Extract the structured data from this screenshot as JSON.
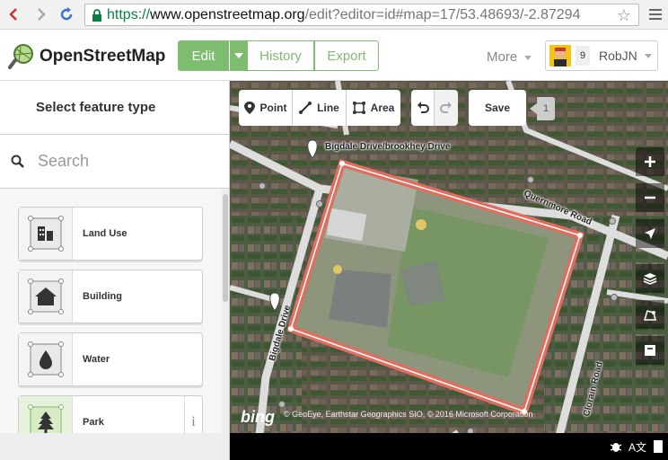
{
  "browser": {
    "url_scheme": "https://",
    "url_host": "www.openstreetmap.org",
    "url_path": "/edit?editor=id#map=17/53.48693/-2.87294"
  },
  "header": {
    "site_name": "OpenStreetMap",
    "tabs": {
      "edit": "Edit",
      "history": "History",
      "export": "Export"
    },
    "more_label": "More",
    "user": {
      "count": "9",
      "name": "RobJN"
    }
  },
  "sidebar": {
    "title": "Select feature type",
    "search_placeholder": "Search",
    "presets": [
      {
        "label": "Land Use",
        "icon": "land-use-icon"
      },
      {
        "label": "Building",
        "icon": "building-icon"
      },
      {
        "label": "Water",
        "icon": "water-icon"
      },
      {
        "label": "Park",
        "icon": "park-icon"
      }
    ],
    "info_glyph": "i"
  },
  "toolbar": {
    "point": "Point",
    "line": "Line",
    "area": "Area",
    "save": "Save",
    "save_count": "1"
  },
  "map": {
    "labels": {
      "bigdale_brookhey": "Bigdale Drive/brookhey Drive",
      "quernmore": "Quernmore Road",
      "bigdale": "Bigdale Drive",
      "clorain": "Clorain Road"
    },
    "attribution": "© GeoEye, Earthstar Geographics SIO, © 2016 Microsoft Corporation",
    "imagery_logo": "bing",
    "selection_color": "#e06e5f",
    "accent": "#7ebc6f"
  },
  "footer": {
    "translate": "A文"
  }
}
